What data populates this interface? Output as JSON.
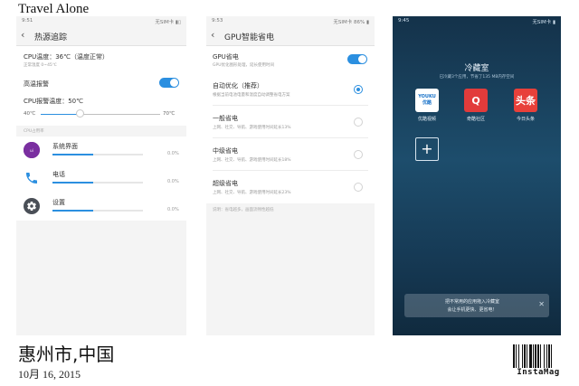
{
  "card": {
    "title": "Travel Alone",
    "location": "惠州市,中国",
    "date": "10月 16, 2015",
    "brand": "InstaMag"
  },
  "phone1": {
    "status": {
      "time": "9:51",
      "right": "无SIM卡 ▮▯"
    },
    "header": {
      "back": "‹",
      "title": "热源追踪"
    },
    "cpu_temp": {
      "label": "CPU温度：36℃（温度正常）",
      "sub": "正常温度 0~45℃"
    },
    "high_temp_alarm": {
      "label": "高温报警",
      "enabled": true
    },
    "alarm_temp": {
      "label": "CPU报警温度：50℃",
      "min": "40℃",
      "max": "70℃",
      "value": 50,
      "range": [
        40,
        70
      ]
    },
    "apps_group_label": "CPU占用率",
    "apps": [
      {
        "name": "系统界面",
        "percent": "0.0%",
        "icon": "system-ui-icon",
        "fill": 0.45
      },
      {
        "name": "电话",
        "percent": "0.0%",
        "icon": "phone-icon",
        "fill": 0.45
      },
      {
        "name": "设置",
        "percent": "0.0%",
        "icon": "gear-icon",
        "fill": 0.45
      }
    ]
  },
  "phone2": {
    "status": {
      "time": "9:53",
      "right": "无SIM卡 86% ▮"
    },
    "header": {
      "back": "‹",
      "title": "GPU智能省电"
    },
    "gpu_power": {
      "label": "GPU省电",
      "sub": "GPU优化图形处理，延长使用时间",
      "enabled": true
    },
    "options": [
      {
        "label": "自动优化（推荐）",
        "sub": "根据当前电池电量和温度自动调整省电方案",
        "selected": true
      },
      {
        "label": "一般省电",
        "sub": "上网、社交、导航、游戏使用时间延长13%",
        "selected": false
      },
      {
        "label": "中级省电",
        "sub": "上网、社交、导航、游戏使用时间延长18%",
        "selected": false
      },
      {
        "label": "超级省电",
        "sub": "上网、社交、导航、游戏使用时间延长23%",
        "selected": false
      }
    ],
    "note": "说明：省电越多，画面流畅性越低"
  },
  "phone3": {
    "status": {
      "time": "9:45",
      "right": "无SIM卡 ▮"
    },
    "title": "冷藏室",
    "subtitle": "已冷藏3个应用，节省了135 MB内存空间",
    "apps": [
      {
        "name": "优酷视频",
        "icon": "youku-icon",
        "tile_text": "YOUKU 优酷",
        "color": "#ffffff",
        "text_color": "#1a73c9"
      },
      {
        "name": "奇酷社区",
        "icon": "qiku-icon",
        "tile_text": "Q",
        "color": "#e23b3b",
        "text_color": "#ffffff"
      },
      {
        "name": "今日头条",
        "icon": "toutiao-icon",
        "tile_text": "头条",
        "color": "#e8403a",
        "text_color": "#ffffff"
      }
    ],
    "add_label": "+",
    "toast": {
      "line1": "把不常用的应用拖入冷藏室",
      "line2": "会让手机更快、更省电！",
      "close": "✕"
    }
  }
}
